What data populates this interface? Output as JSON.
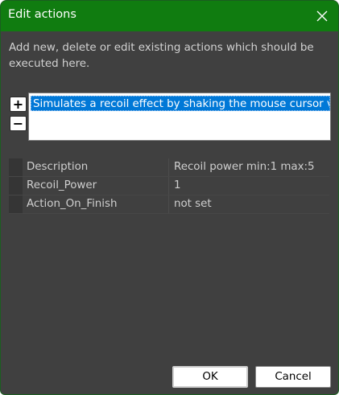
{
  "window": {
    "title": "Edit actions"
  },
  "instructions": "Add new, delete or edit existing actions which should be executed here.",
  "list": {
    "add_label": "+",
    "remove_label": "−",
    "items": [
      "Simulates a recoil effect by shaking the mouse cursor ve"
    ]
  },
  "properties": [
    {
      "name": "Description",
      "value": "Recoil power min:1 max:5"
    },
    {
      "name": "Recoil_Power",
      "value": "1"
    },
    {
      "name": "Action_On_Finish",
      "value": "not set"
    }
  ],
  "buttons": {
    "ok": "OK",
    "cancel": "Cancel"
  },
  "colors": {
    "titlebar": "#107c10",
    "background": "#404040",
    "selection": "#0078d7"
  }
}
